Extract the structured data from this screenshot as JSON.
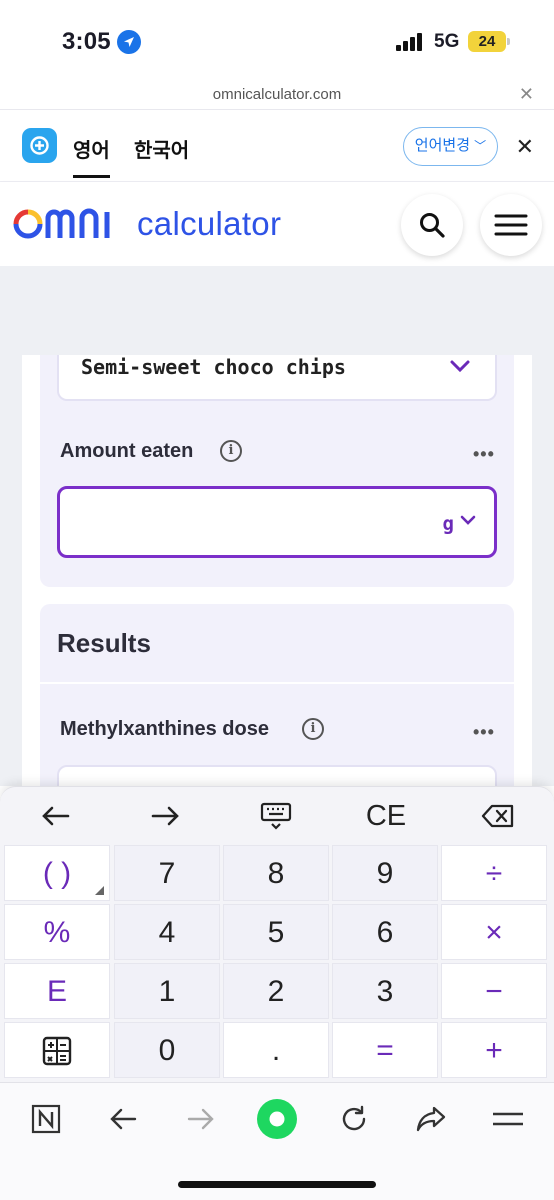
{
  "status": {
    "time": "3:05",
    "network": "5G",
    "battery": "24"
  },
  "browser": {
    "url": "omnicalculator.com"
  },
  "lang_bar": {
    "tab_en": "영어",
    "tab_ko": "한국어",
    "change_label": "언어변경"
  },
  "header": {
    "brand": "calculator"
  },
  "form": {
    "chocolate_select_value": "Semi-sweet choco chips",
    "amount_label": "Amount eaten",
    "amount_unit": "g",
    "amount_value": ""
  },
  "results": {
    "title": "Results",
    "dose_label": "Methylxanthines dose"
  },
  "keyboard": {
    "tools": {
      "ce": "CE"
    },
    "rows": [
      [
        "( )",
        "7",
        "8",
        "9",
        "÷"
      ],
      [
        "%",
        "4",
        "5",
        "6",
        "×"
      ],
      [
        "E",
        "1",
        "2",
        "3",
        "−"
      ],
      [
        "",
        "0",
        ".",
        "=",
        "+"
      ]
    ]
  },
  "colors": {
    "accent": "#6a2ab8",
    "brand_blue": "#2e53e6",
    "browser_green": "#1ed760"
  }
}
